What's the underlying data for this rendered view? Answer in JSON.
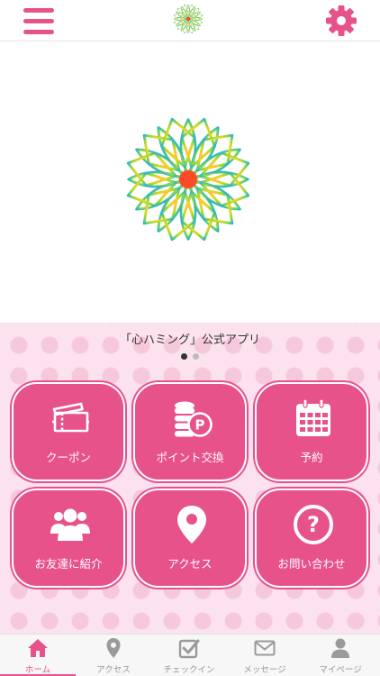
{
  "header": {
    "menu_icon": "hamburger-menu-icon",
    "logo": "flower-mandala-logo",
    "settings_icon": "gear-icon"
  },
  "hero": {
    "logo": "flower-mandala-logo"
  },
  "app_subtitle": "「心ハミング」公式アプリ",
  "carousel": {
    "pages": 2,
    "active_page": 1
  },
  "tiles": [
    {
      "label": "クーポン",
      "icon": "ticket-icon"
    },
    {
      "label": "ポイント交換",
      "icon": "coins-p-icon"
    },
    {
      "label": "予約",
      "icon": "calendar-icon"
    },
    {
      "label": "お友達に紹介",
      "icon": "people-group-icon"
    },
    {
      "label": "アクセス",
      "icon": "map-pin-icon"
    },
    {
      "label": "お問い合わせ",
      "icon": "question-icon"
    }
  ],
  "bottom_nav": {
    "items": [
      {
        "label": "ホーム",
        "icon": "home-icon",
        "active": true
      },
      {
        "label": "アクセス",
        "icon": "map-pin-icon",
        "active": false
      },
      {
        "label": "チェックイン",
        "icon": "checkin-icon",
        "active": false
      },
      {
        "label": "メッセージ",
        "icon": "envelope-icon",
        "active": false
      },
      {
        "label": "マイページ",
        "icon": "user-icon",
        "active": false
      }
    ]
  },
  "colors": {
    "accent": "#e8528b",
    "panel_background": "#fbe2ee",
    "panel_dots": "#f6c8dc",
    "nav_inactive": "#9a9a9a"
  }
}
